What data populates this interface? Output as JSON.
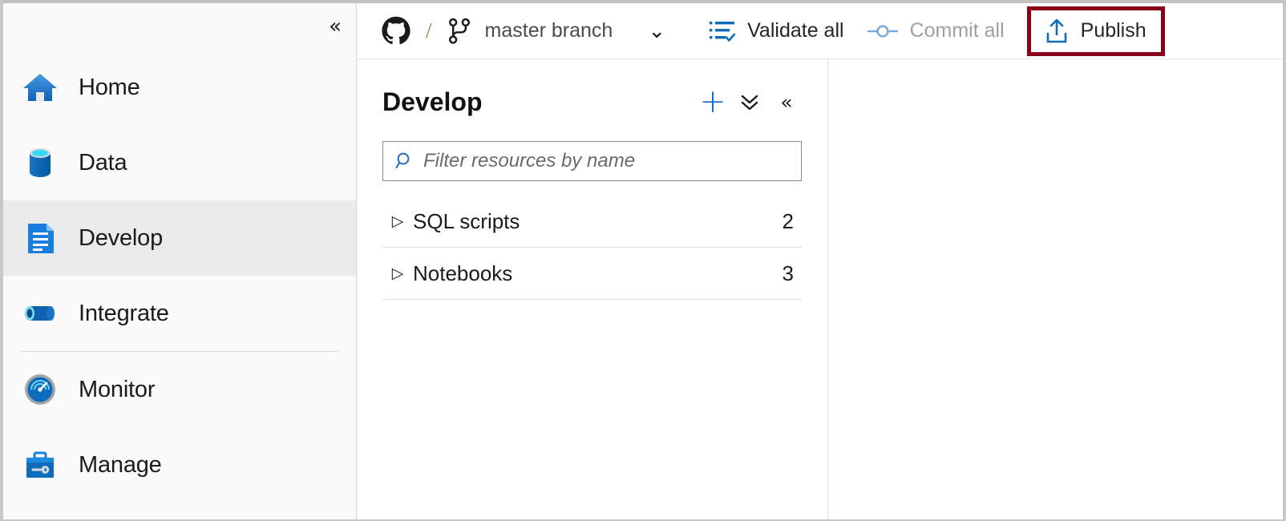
{
  "colors": {
    "accent_blue": "#0f6cbd",
    "highlight_red": "#8b0016",
    "selected_nav_bg": "#ebebeb",
    "sidebar_bg": "#fafafa",
    "disabled_text": "#a0a0a0"
  },
  "sidebar": {
    "collapse_icon": "chevron-double-left-icon",
    "items": [
      {
        "label": "Home",
        "icon": "home-icon",
        "selected": false
      },
      {
        "label": "Data",
        "icon": "database-icon",
        "selected": false
      },
      {
        "label": "Develop",
        "icon": "document-icon",
        "selected": true
      },
      {
        "label": "Integrate",
        "icon": "pipeline-icon",
        "selected": false
      },
      {
        "label": "Monitor",
        "icon": "gauge-icon",
        "selected": false
      },
      {
        "label": "Manage",
        "icon": "toolbox-icon",
        "selected": false
      }
    ]
  },
  "toolbar": {
    "source_control_icon": "github-icon",
    "separator": "/",
    "branch_icon": "git-branch-icon",
    "branch_name": "master branch",
    "branch_dropdown_icon": "chevron-down-icon",
    "validate_label": "Validate all",
    "validate_icon": "validate-list-check-icon",
    "commit_label": "Commit all",
    "commit_icon": "git-commit-icon",
    "commit_disabled": true,
    "publish_label": "Publish",
    "publish_icon": "publish-upload-icon",
    "publish_highlighted": true
  },
  "develop_panel": {
    "title": "Develop",
    "actions": [
      {
        "name": "add-new-resource",
        "icon": "plus-icon"
      },
      {
        "name": "collapse-all",
        "icon": "chevron-double-down-icon"
      },
      {
        "name": "collapse-panel",
        "icon": "chevron-double-left-icon"
      }
    ],
    "filter": {
      "icon": "search-icon",
      "placeholder": "Filter resources by name",
      "value": ""
    },
    "tree": [
      {
        "caret": "▷",
        "label": "SQL scripts",
        "count": "2"
      },
      {
        "caret": "▷",
        "label": "Notebooks",
        "count": "3"
      }
    ]
  }
}
